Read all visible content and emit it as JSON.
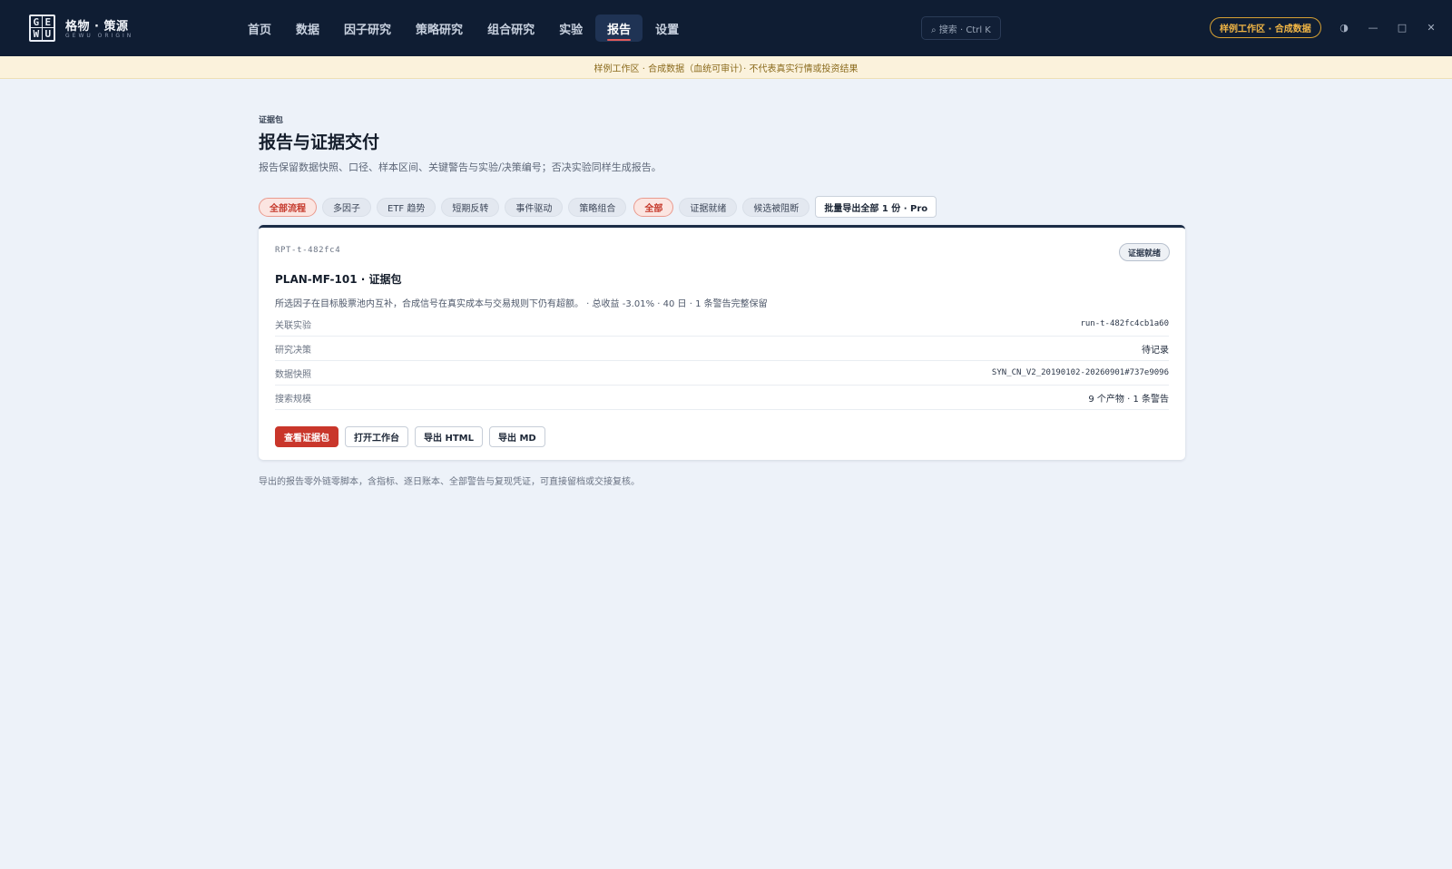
{
  "brand": {
    "logo_letters": [
      "G",
      "E",
      "W",
      "U"
    ],
    "name": "格物 · 策源",
    "subtitle": "GEWU ORIGIN"
  },
  "nav": {
    "items": [
      {
        "label": "首页",
        "active": false
      },
      {
        "label": "数据",
        "active": false
      },
      {
        "label": "因子研究",
        "active": false
      },
      {
        "label": "策略研究",
        "active": false
      },
      {
        "label": "组合研究",
        "active": false
      },
      {
        "label": "实验",
        "active": false
      },
      {
        "label": "报告",
        "active": true
      },
      {
        "label": "设置",
        "active": false
      }
    ]
  },
  "search": {
    "label": "⌕ 搜索 · Ctrl K"
  },
  "workspace_badge": "样例工作区 · 合成数据",
  "window_controls": {
    "theme": "◑",
    "minimize": "—",
    "maximize": "□",
    "close": "✕"
  },
  "notice": "样例工作区 · 合成数据（血统可审计）· 不代表真实行情或投资结果",
  "page": {
    "eyebrow": "证据包",
    "title": "报告与证据交付",
    "description": "报告保留数据快照、口径、样本区间、关键警告与实验/决策编号；否决实验同样生成报告。"
  },
  "filters": {
    "flow_chips": [
      {
        "label": "全部流程",
        "active": true
      },
      {
        "label": "多因子",
        "active": false
      },
      {
        "label": "ETF 趋势",
        "active": false
      },
      {
        "label": "短期反转",
        "active": false
      },
      {
        "label": "事件驱动",
        "active": false
      },
      {
        "label": "策略组合",
        "active": false
      }
    ],
    "status_chips": [
      {
        "label": "全部",
        "active": true
      },
      {
        "label": "证据就绪",
        "active": false
      },
      {
        "label": "候选被阻断",
        "active": false
      }
    ],
    "bulk_export_label": "批量导出全部 1 份 · Pro"
  },
  "report": {
    "id": "RPT-t-482fc4",
    "status": "证据就绪",
    "title": "PLAN-MF-101 · 证据包",
    "summary": "所选因子在目标股票池内互补，合成信号在真实成本与交易规则下仍有超额。 · 总收益 -3.01% · 40 日 · 1 条警告完整保留",
    "fields": [
      {
        "key": "关联实验",
        "value": "run-t-482fc4cb1a60",
        "mono": true
      },
      {
        "key": "研究决策",
        "value": "待记录",
        "mono": false
      },
      {
        "key": "数据快照",
        "value": "SYN_CN_V2_20190102-20260901#737e9096",
        "mono": true
      },
      {
        "key": "搜索规模",
        "value": "9 个产物 · 1 条警告",
        "mono": false
      }
    ],
    "actions": {
      "view": "查看证据包",
      "open_workbench": "打开工作台",
      "export_html": "导出 HTML",
      "export_md": "导出 MD"
    }
  },
  "footnote": "导出的报告零外链零脚本，含指标、逐日账本、全部警告与复现凭证，可直接留档或交接复核。"
}
